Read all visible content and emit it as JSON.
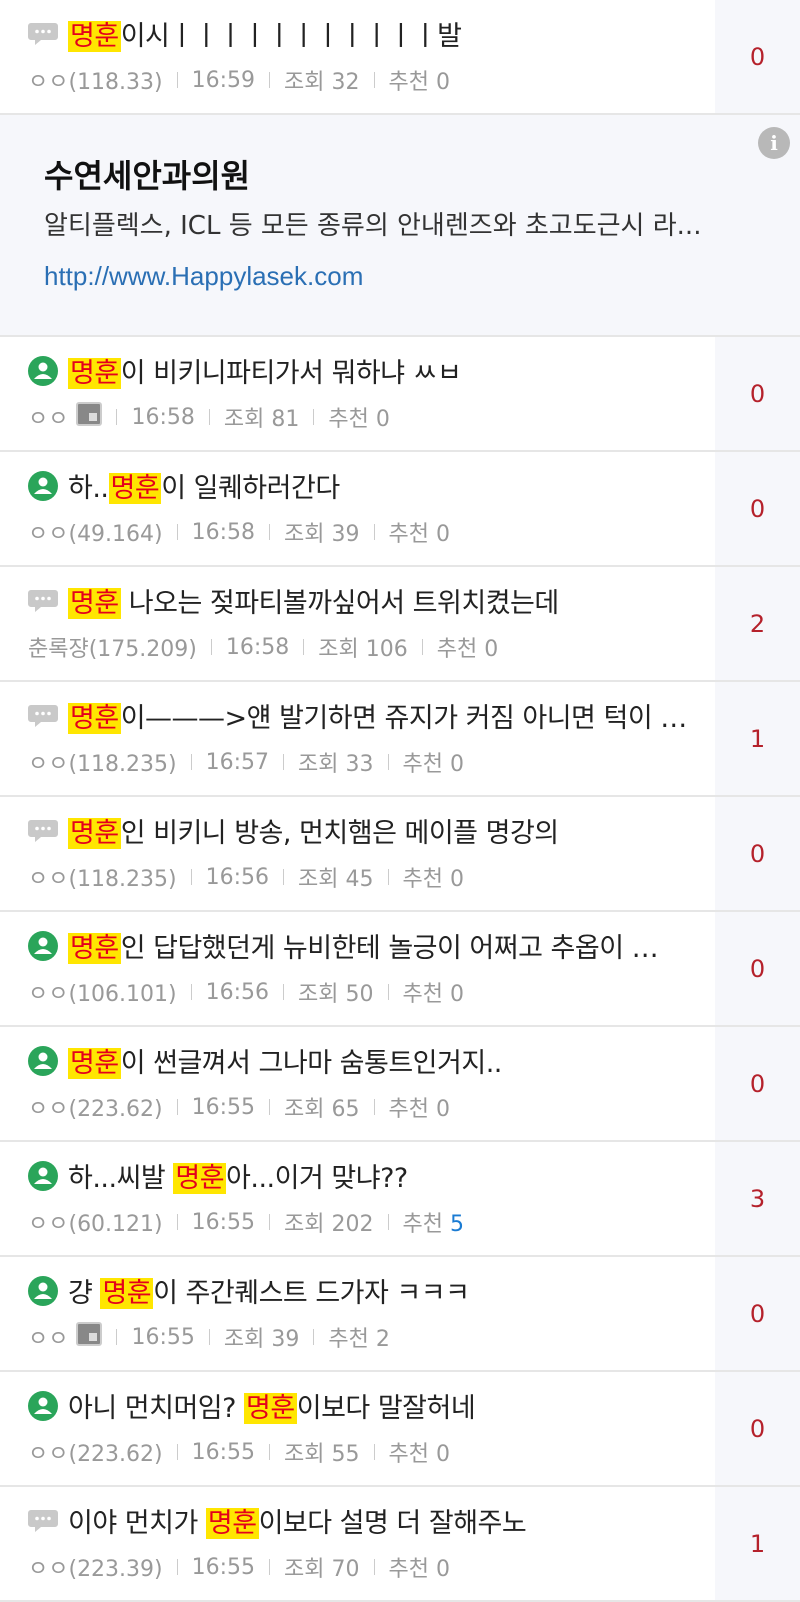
{
  "highlight_color": "#ffe600",
  "highlight_text_color": "#e4001b",
  "count_color": "#b5212b",
  "posts": [
    {
      "icon": "speech-bubble-icon",
      "pre": "",
      "hl": "명훈",
      "post": "이시ㅣㅣㅣㅣㅣㅣㅣㅣㅣㅣㅣ발",
      "author": "ㅇㅇ(118.33)",
      "time": "16:59",
      "views": "조회 32",
      "rec_label": "추천",
      "rec": "0",
      "rec_blue": false,
      "img": false,
      "count": "0"
    },
    {
      "icon": "person-green-icon",
      "pre": "",
      "hl": "명훈",
      "post": "이 비키니파티가서 뭐하냐 ㅆㅂ",
      "author": "ㅇㅇ",
      "time": "16:58",
      "views": "조회 81",
      "rec_label": "추천",
      "rec": "0",
      "rec_blue": false,
      "img": true,
      "count": "0"
    },
    {
      "icon": "person-green-icon",
      "pre": "하..",
      "hl": "명훈",
      "post": "이 일퀘하러간다",
      "author": "ㅇㅇ(49.164)",
      "time": "16:58",
      "views": "조회 39",
      "rec_label": "추천",
      "rec": "0",
      "rec_blue": false,
      "img": false,
      "count": "0"
    },
    {
      "icon": "speech-bubble-icon",
      "pre": "",
      "hl": "명훈",
      "post": " 나오는 젖파티볼까싶어서 트위치켰는데",
      "author": "춘록쟝(175.209)",
      "time": "16:58",
      "views": "조회 106",
      "rec_label": "추천",
      "rec": "0",
      "rec_blue": false,
      "img": false,
      "count": "2"
    },
    {
      "icon": "speech-bubble-icon",
      "pre": "",
      "hl": "명훈",
      "post": "이———>얜 발기하면 쥬지가 커짐 아니면 턱이 …",
      "author": "ㅇㅇ(118.235)",
      "time": "16:57",
      "views": "조회 33",
      "rec_label": "추천",
      "rec": "0",
      "rec_blue": false,
      "img": false,
      "count": "1"
    },
    {
      "icon": "speech-bubble-icon",
      "pre": "",
      "hl": "명훈",
      "post": "인 비키니 방송, 먼치햄은 메이플 명강의",
      "author": "ㅇㅇ(118.235)",
      "time": "16:56",
      "views": "조회 45",
      "rec_label": "추천",
      "rec": "0",
      "rec_blue": false,
      "img": false,
      "count": "0"
    },
    {
      "icon": "person-green-icon",
      "pre": "",
      "hl": "명훈",
      "post": "인 답답했던게 뉴비한테 놀긍이 어쩌고 추옵이 …",
      "author": "ㅇㅇ(106.101)",
      "time": "16:56",
      "views": "조회 50",
      "rec_label": "추천",
      "rec": "0",
      "rec_blue": false,
      "img": false,
      "count": "0"
    },
    {
      "icon": "person-green-icon",
      "pre": "",
      "hl": "명훈",
      "post": "이 썬글껴서 그나마 숨통트인거지..",
      "author": "ㅇㅇ(223.62)",
      "time": "16:55",
      "views": "조회 65",
      "rec_label": "추천",
      "rec": "0",
      "rec_blue": false,
      "img": false,
      "count": "0"
    },
    {
      "icon": "person-green-icon",
      "pre": "하...씨발 ",
      "hl": "명훈",
      "post": "아...이거 맞냐??",
      "author": "ㅇㅇ(60.121)",
      "time": "16:55",
      "views": "조회 202",
      "rec_label": "추천",
      "rec": "5",
      "rec_blue": true,
      "img": false,
      "count": "3"
    },
    {
      "icon": "person-green-icon",
      "pre": "걍 ",
      "hl": "명훈",
      "post": "이 주간퀘스트 드가자 ㅋㅋㅋ",
      "author": "ㅇㅇ",
      "time": "16:55",
      "views": "조회 39",
      "rec_label": "추천",
      "rec": "2",
      "rec_blue": false,
      "img": true,
      "count": "0"
    },
    {
      "icon": "person-green-icon",
      "pre": "아니 먼치머임? ",
      "hl": "명훈",
      "post": "이보다 말잘허네",
      "author": "ㅇㅇ(223.62)",
      "time": "16:55",
      "views": "조회 55",
      "rec_label": "추천",
      "rec": "0",
      "rec_blue": false,
      "img": false,
      "count": "0"
    },
    {
      "icon": "speech-bubble-icon",
      "pre": "이야 먼치가 ",
      "hl": "명훈",
      "post": "이보다 설명 더 잘해주노",
      "author": "ㅇㅇ(223.39)",
      "time": "16:55",
      "views": "조회 70",
      "rec_label": "추천",
      "rec": "0",
      "rec_blue": false,
      "img": false,
      "count": "1"
    }
  ],
  "ad": {
    "info_label": "i",
    "title": "수연세안과의원",
    "description": "알티플렉스, ICL 등 모든 종류의 안내렌즈와 초고도근시 라...",
    "url": "http://www.Happylasek.com"
  }
}
